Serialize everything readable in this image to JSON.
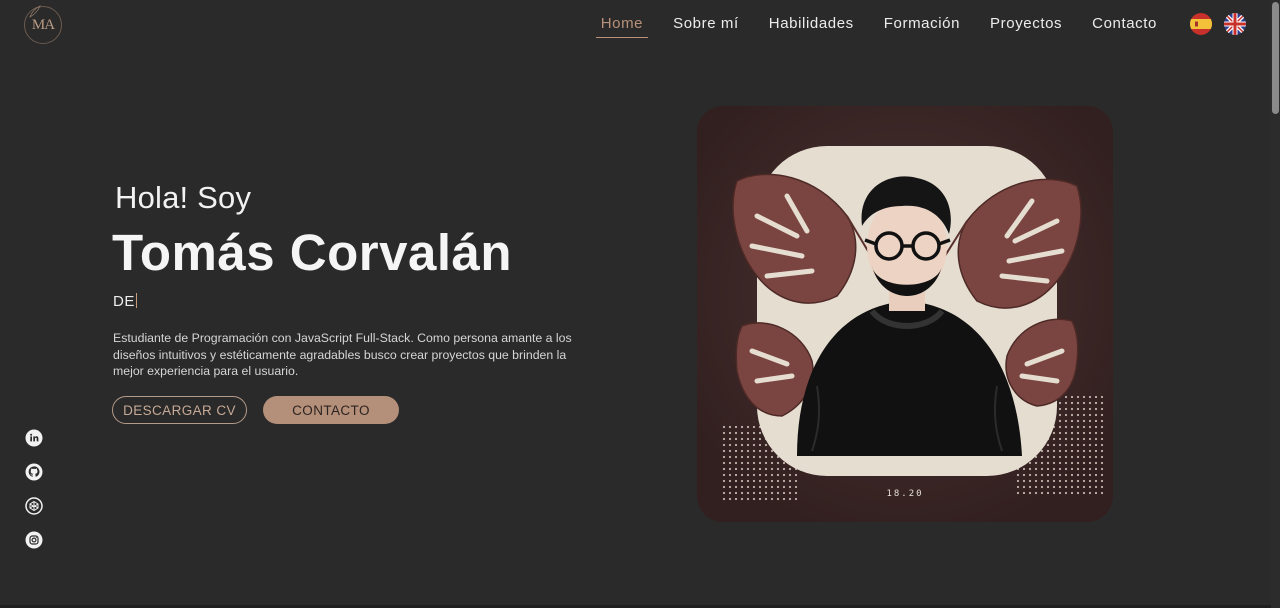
{
  "header": {
    "logo_text": "MA",
    "nav": [
      {
        "label": "Home",
        "active": true
      },
      {
        "label": "Sobre mí",
        "active": false
      },
      {
        "label": "Habilidades",
        "active": false
      },
      {
        "label": "Formación",
        "active": false
      },
      {
        "label": "Proyectos",
        "active": false
      },
      {
        "label": "Contacto",
        "active": false
      }
    ],
    "languages": [
      {
        "icon": "spain-flag-icon"
      },
      {
        "icon": "uk-flag-icon"
      }
    ]
  },
  "hero": {
    "greeting": "Hola! Soy",
    "name": "Tomás Corvalán",
    "typing_text": "DE",
    "description": "Estudiante de Programación con JavaScript Full-Stack. Como persona amante a los diseños intuitivos y estéticamente agradables busco crear proyectos que brinden la mejor experiencia para el usuario.",
    "download_cv": "DESCARGAR CV",
    "contact": "CONTACTO"
  },
  "illustration": {
    "caption": "18.20"
  },
  "socials": [
    {
      "icon": "linkedin-icon"
    },
    {
      "icon": "github-icon"
    },
    {
      "icon": "codepen-icon"
    },
    {
      "icon": "instagram-icon"
    }
  ],
  "colors": {
    "background": "#2a2a2a",
    "accent": "#b8917a",
    "text": "#ececec"
  }
}
